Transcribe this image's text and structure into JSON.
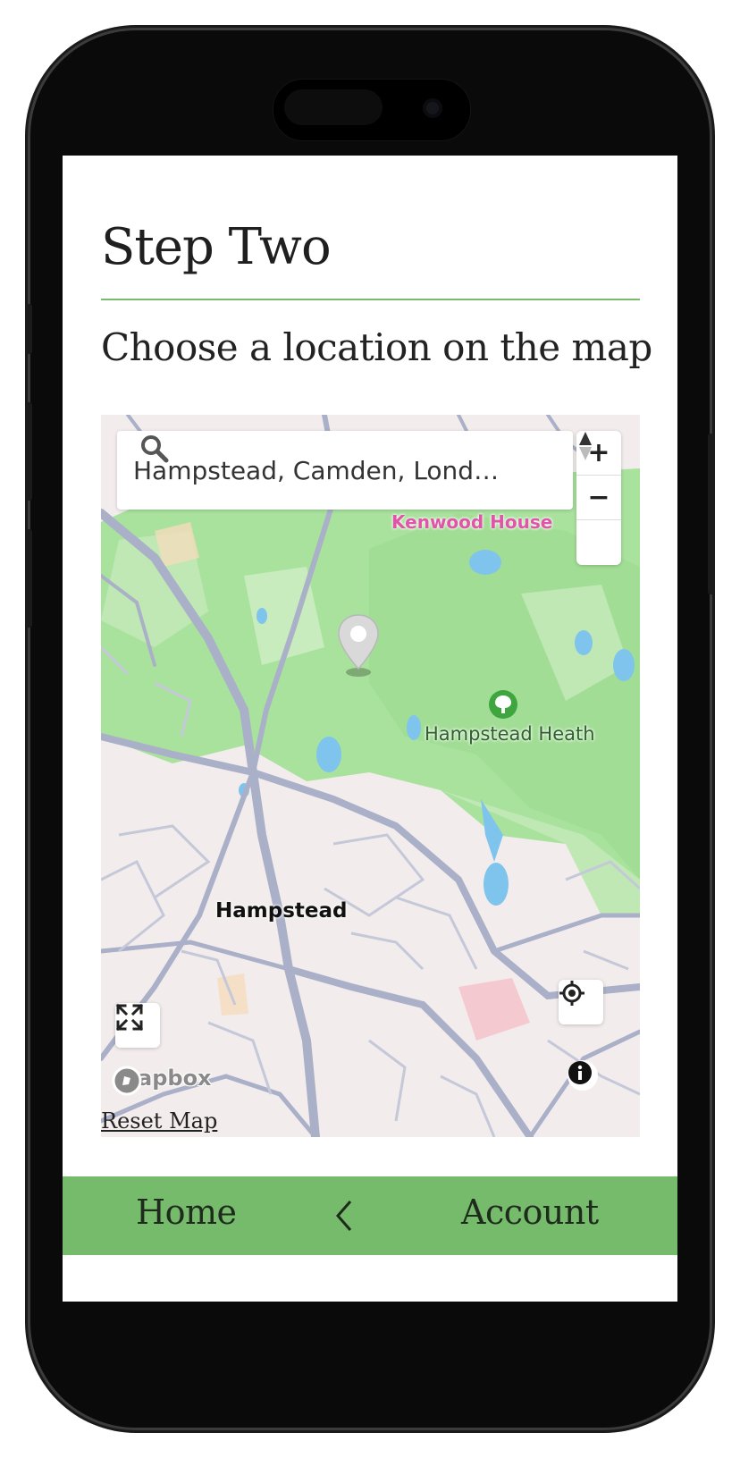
{
  "page": {
    "step_title": "Step Two",
    "subtitle": "Choose a location on the map",
    "reset_label": "Reset Map"
  },
  "search": {
    "value": "Hampstead, Camden, Londo…",
    "icon": "search-icon"
  },
  "map": {
    "labels": {
      "kenwood": "Kenwood House",
      "heath": "Hampstead Heath",
      "hampstead": "Hampstead",
      "brand": "mapbox"
    },
    "controls": {
      "zoom_in": "+",
      "zoom_out": "−",
      "icons": [
        "compass-icon",
        "geolocate-icon",
        "fullscreen-icon",
        "info-icon",
        "location-pin-icon"
      ]
    },
    "colors": {
      "park": "#a8e29d",
      "water": "#7ec4ec",
      "road": "#aab0c8",
      "land": "#f3ecec",
      "poi_pink": "#e055a8",
      "poi_green": "#3fa53f"
    }
  },
  "nav": {
    "home": "Home",
    "back_icon": "chevron-left-icon",
    "account": "Account",
    "color": "#75bb6b"
  },
  "theme": {
    "divider": "#7aba6c"
  }
}
